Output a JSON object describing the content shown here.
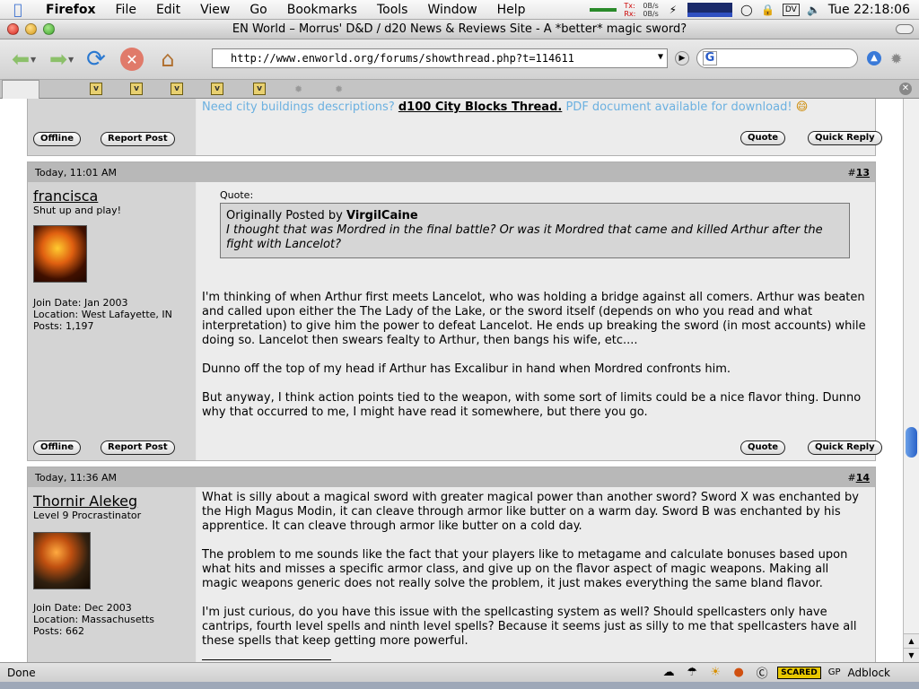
{
  "menubar": {
    "app": "Firefox",
    "items": [
      "File",
      "Edit",
      "View",
      "Go",
      "Bookmarks",
      "Tools",
      "Window",
      "Help"
    ],
    "net_tx_label": "Tx:",
    "net_rx_label": "Rx:",
    "net_tx": "0B/s",
    "net_rx": "0B/s",
    "dv": "DV",
    "clock": "Tue 22:18:06"
  },
  "window": {
    "title": "EN World – Morrus' D&D / d20 News & Reviews Site - A *better* magic sword?"
  },
  "navbar": {
    "url": "http://www.enworld.org/forums/showthread.php?t=114611",
    "search_engine": "G"
  },
  "colors": {
    "post_header": "#b8b8b8",
    "user_column": "#d4d4d4",
    "body_column": "#ececec",
    "signature_link": "#6bb0e0"
  },
  "previous_post": {
    "sig_before": "Need city buildings descriptions?",
    "sig_link": "d100 City Blocks Thread.",
    "sig_after": "PDF document available for download!",
    "btn_offline": "Offline",
    "btn_report": "Report Post",
    "btn_quote": "Quote",
    "btn_quick_reply": "Quick Reply"
  },
  "posts": [
    {
      "date": "Today, 11:01 AM",
      "hash": "#",
      "number": "13",
      "username": "francisca",
      "user_title": "Shut up and play!",
      "join_date": "Join Date: Jan 2003",
      "location": "Location: West Lafayette, IN",
      "posts": "Posts: 1,197",
      "quote_label": "Quote:",
      "quote_prefix": "Originally Posted by",
      "quote_author": "VirgilCaine",
      "quote_text": "I thought that was Mordred in the final battle? Or was it Mordred that came and killed Arthur after the fight with Lancelot?",
      "paragraphs": [
        "I'm thinking of when Arthur first meets Lancelot, who was holding a bridge against all comers. Arthur was beaten and called upon either the The Lady of the Lake, or the sword itself (depends on who you read and what interpretation) to give him the power to defeat Lancelot. He ends up breaking the sword (in most accounts) while doing so. Lancelot then swears fealty to Arthur, then bangs his wife, etc....",
        "Dunno off the top of my head if Arthur has Excalibur in hand when Mordred confronts him.",
        "But anyway, I think action points tied to the weapon, with some sort of limits could be a nice flavor thing. Dunno why that occurred to me, I might have read it somewhere, but there you go."
      ],
      "btn_offline": "Offline",
      "btn_report": "Report Post",
      "btn_quote": "Quote",
      "btn_quick_reply": "Quick Reply"
    },
    {
      "date": "Today, 11:36 AM",
      "hash": "#",
      "number": "14",
      "username": "Thornir Alekeg",
      "user_title": "Level 9 Procrastinator",
      "join_date": "Join Date: Dec 2003",
      "location": "Location: Massachusetts",
      "posts": "Posts: 662",
      "paragraphs": [
        "What is silly about a magical sword with greater magical power than another sword? Sword X was enchanted by the High Magus Modin, it can cleave through armor like butter on a warm day. Sword B was enchanted by his apprentice. It can cleave through armor like butter on a cold day.",
        "The problem to me sounds like the fact that your players like to metagame and calculate bonuses based upon what hits and misses a specific armor class, and give up on the flavor aspect of magic weapons. Making all magic weapons generic does not really solve the problem, it just makes everything the same bland flavor.",
        "I'm just curious, do you have this issue with the spellcasting system as well? Should spellcasters only have cantrips, fourth level spells and ninth level spells? Because it seems just as silly to me that spellcasters have all these spells that keep getting more powerful."
      ]
    }
  ],
  "statusbar": {
    "status": "Done",
    "scared": "SCARED",
    "gp": "GP",
    "adblock": "Adblock"
  }
}
